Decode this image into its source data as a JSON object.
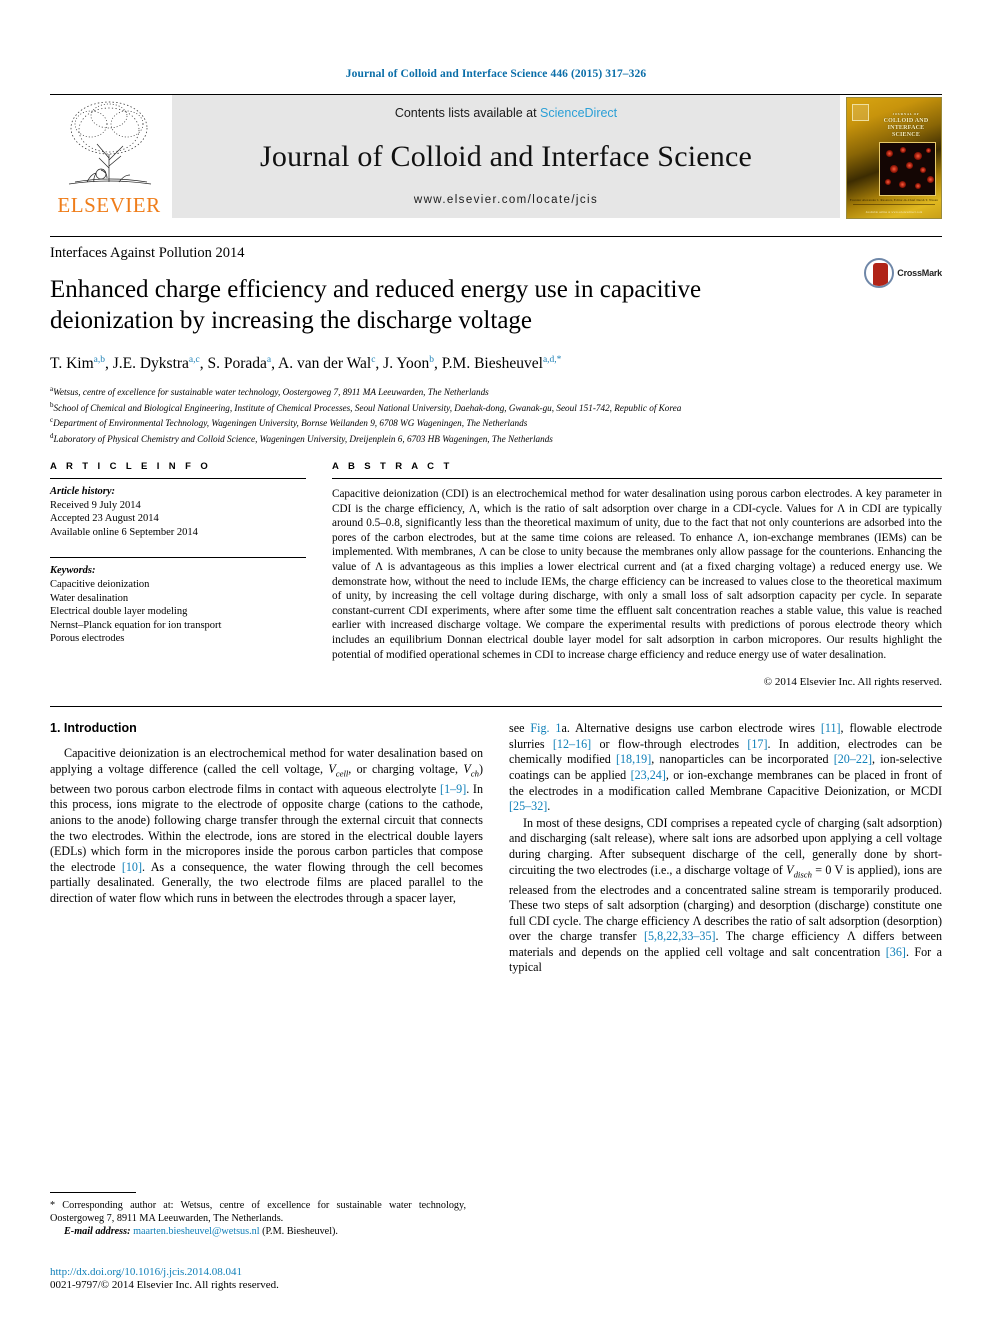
{
  "running_head": "Journal of Colloid and Interface Science 446 (2015) 317–326",
  "masthead": {
    "contents_prefix": "Contents lists available at ",
    "sciencedirect": "ScienceDirect",
    "journal_name": "Journal of Colloid and Interface Science",
    "journal_url": "www.elsevier.com/locate/jcis",
    "publisher": "ELSEVIER",
    "cover_kicker": "JOURNAL OF",
    "cover_title": "COLLOID AND INTERFACE SCIENCE",
    "cover_footer": "Available online at www.sciencedirect.com",
    "cover_caption": "Founder Alexander I. Rusanov, Editor-in-Chief Darsh T. Wasan"
  },
  "series_line": "Interfaces Against Pollution 2014",
  "title": "Enhanced charge efficiency and reduced energy use in capacitive deionization by increasing the discharge voltage",
  "crossmark_label": "CrossMark",
  "authors": [
    {
      "name": "T. Kim",
      "sup": "a,b"
    },
    {
      "name": "J.E. Dykstra",
      "sup": "a,c"
    },
    {
      "name": "S. Porada",
      "sup": "a"
    },
    {
      "name": "A. van der Wal",
      "sup": "c"
    },
    {
      "name": "J. Yoon",
      "sup": "b"
    },
    {
      "name": "P.M. Biesheuvel",
      "sup": "a,d,*"
    }
  ],
  "affiliations": [
    {
      "marker": "a",
      "text": "Wetsus, centre of excellence for sustainable water technology, Oostergoweg 7, 8911 MA Leeuwarden, The Netherlands"
    },
    {
      "marker": "b",
      "text": "School of Chemical and Biological Engineering, Institute of Chemical Processes, Seoul National University, Daehak-dong, Gwanak-gu, Seoul 151-742, Republic of Korea"
    },
    {
      "marker": "c",
      "text": "Department of Environmental Technology, Wageningen University, Bornse Weilanden 9, 6708 WG Wageningen, The Netherlands"
    },
    {
      "marker": "d",
      "text": "Laboratory of Physical Chemistry and Colloid Science, Wageningen University, Dreijenplein 6, 6703 HB Wageningen, The Netherlands"
    }
  ],
  "article_info": {
    "heading": "A R T I C L E   I N F O",
    "history_label": "Article history:",
    "history": [
      "Received 9 July 2014",
      "Accepted 23 August 2014",
      "Available online 6 September 2014"
    ],
    "keywords_label": "Keywords:",
    "keywords": [
      "Capacitive deionization",
      "Water desalination",
      "Electrical double layer modeling",
      "Nernst–Planck equation for ion transport",
      "Porous electrodes"
    ]
  },
  "abstract": {
    "heading": "A B S T R A C T",
    "text": "Capacitive deionization (CDI) is an electrochemical method for water desalination using porous carbon electrodes. A key parameter in CDI is the charge efficiency, Λ, which is the ratio of salt adsorption over charge in a CDI-cycle. Values for Λ in CDI are typically around 0.5–0.8, significantly less than the theoretical maximum of unity, due to the fact that not only counterions are adsorbed into the pores of the carbon electrodes, but at the same time coions are released. To enhance Λ, ion-exchange membranes (IEMs) can be implemented. With membranes, Λ can be close to unity because the membranes only allow passage for the counterions. Enhancing the value of Λ is advantageous as this implies a lower electrical current and (at a fixed charging voltage) a reduced energy use. We demonstrate how, without the need to include IEMs, the charge efficiency can be increased to values close to the theoretical maximum of unity, by increasing the cell voltage during discharge, with only a small loss of salt adsorption capacity per cycle. In separate constant-current CDI experiments, where after some time the effluent salt concentration reaches a stable value, this value is reached earlier with increased discharge voltage. We compare the experimental results with predictions of porous electrode theory which includes an equilibrium Donnan electrical double layer model for salt adsorption in carbon micropores. Our results highlight the potential of modified operational schemes in CDI to increase charge efficiency and reduce energy use of water desalination.",
    "copyright": "© 2014 Elsevier Inc. All rights reserved."
  },
  "body": {
    "section_title": "1. Introduction",
    "left_paragraph_1_a": "Capacitive deionization is an electrochemical method for water desalination based on applying a voltage difference (called the cell voltage, ",
    "left_paragraph_1_v1": "V",
    "left_paragraph_1_v1sub": "cell",
    "left_paragraph_1_b": ", or charging voltage, ",
    "left_paragraph_1_v2": "V",
    "left_paragraph_1_v2sub": "ch",
    "left_paragraph_1_c": ") between two porous carbon electrode films in contact with aqueous electrolyte ",
    "left_ref_1_9": "[1–9]",
    "left_paragraph_1_d": ". In this process, ions migrate to the electrode of opposite charge (cations to the cathode, anions to the anode) following charge transfer through the external circuit that connects the two electrodes. Within the electrode, ions are stored in the electrical double layers (EDLs) which form in the micropores inside the porous carbon particles that compose the electrode ",
    "left_ref_10": "[10]",
    "left_paragraph_1_e": ". As a consequence, the water flowing through the cell becomes partially desalinated. Generally, the two electrode films are placed parallel to the direction of water flow which runs in between the electrodes through a spacer layer,",
    "right_paragraph_1_a": "see ",
    "right_fig_ref": "Fig. 1",
    "right_paragraph_1_b": "a. Alternative designs use carbon electrode wires ",
    "right_ref_11": "[11]",
    "right_paragraph_1_c": ", flowable electrode slurries ",
    "right_ref_12_16": "[12–16]",
    "right_paragraph_1_d": " or flow-through electrodes ",
    "right_ref_17": "[17]",
    "right_paragraph_1_e": ". In addition, electrodes can be chemically modified ",
    "right_ref_18_19": "[18,19]",
    "right_paragraph_1_f": ", nanoparticles can be incorporated ",
    "right_ref_20_22": "[20–22]",
    "right_paragraph_1_g": ", ion-selective coatings can be applied ",
    "right_ref_23_24": "[23,24]",
    "right_paragraph_1_h": ", or ion-exchange membranes can be placed in front of the electrodes in a modification called Membrane Capacitive Deionization, or MCDI ",
    "right_ref_25_32": "[25–32]",
    "right_paragraph_1_i": ".",
    "right_paragraph_2_a": "In most of these designs, CDI comprises a repeated cycle of charging (salt adsorption) and discharging (salt release), where salt ions are adsorbed upon applying a cell voltage during charging. After subsequent discharge of the cell, generally done by short-circuiting the two electrodes (i.e., a discharge voltage of ",
    "right_paragraph_2_v": "V",
    "right_paragraph_2_vsub": "disch",
    "right_paragraph_2_b": " = 0 V is applied), ions are released from the electrodes and a concentrated saline stream is temporarily produced. These two steps of salt adsorption (charging) and desorption (discharge) constitute one full CDI cycle. The charge efficiency Λ describes the ratio of salt adsorption (desorption) over the charge transfer ",
    "right_ref_5_35": "[5,8,22,33–35]",
    "right_paragraph_2_c": ". The charge efficiency Λ differs between materials and depends on the applied cell voltage and salt concentration ",
    "right_ref_36": "[36]",
    "right_paragraph_2_d": ". For a typical"
  },
  "footnote": {
    "star": "*",
    "text": " Corresponding author at: Wetsus, centre of excellence for sustainable water technology, Oostergoweg 7, 8911 MA Leeuwarden, The Netherlands.",
    "email_label": "E-mail address:",
    "email": "maarten.biesheuvel@wetsus.nl",
    "email_owner": " (P.M. Biesheuvel)."
  },
  "doi": "http://dx.doi.org/10.1016/j.jcis.2014.08.041",
  "issn": "0021-9797/© 2014 Elsevier Inc. All rights reserved.",
  "colors": {
    "link": "#0f7fb8",
    "running_head": "#0b6ea8",
    "elsevier_orange": "#ef7d1a",
    "sciencedirect": "#2a9fd6"
  }
}
